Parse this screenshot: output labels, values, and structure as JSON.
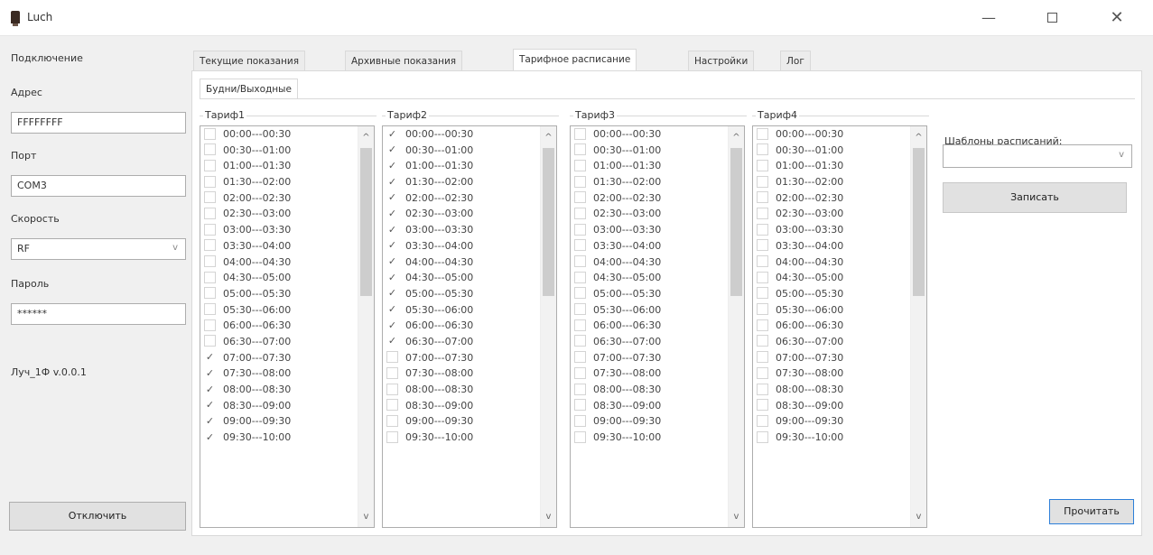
{
  "window": {
    "title": "Luch",
    "minimize_glyph": "—",
    "close_glyph": "✕"
  },
  "connection": {
    "section_title": "Подключение",
    "address_label": "Адрес",
    "address_value": "FFFFFFFF",
    "port_label": "Порт",
    "port_value": "COM3",
    "speed_label": "Скорость",
    "speed_value": "RF",
    "password_label": "Пароль",
    "password_value": "******",
    "version": "Луч_1Ф v.0.0.1",
    "disconnect_label": "Отключить"
  },
  "tabs": [
    {
      "label": "Текущие показания"
    },
    {
      "label": "Архивные показания"
    },
    {
      "label": "Тарифное расписание"
    },
    {
      "label": "Настройки"
    },
    {
      "label": "Лог"
    }
  ],
  "active_tab": "Тарифное расписание",
  "subtab": "Будни/Выходные",
  "tariffs": [
    {
      "name": "Тариф1",
      "checked": [
        false,
        false,
        false,
        false,
        false,
        false,
        false,
        false,
        false,
        false,
        false,
        false,
        false,
        false,
        true,
        true,
        true,
        true,
        true,
        true
      ]
    },
    {
      "name": "Тариф2",
      "checked": [
        true,
        true,
        true,
        true,
        true,
        true,
        true,
        true,
        true,
        true,
        true,
        true,
        true,
        true,
        false,
        false,
        false,
        false,
        false,
        false
      ]
    },
    {
      "name": "Тариф3",
      "checked": [
        false,
        false,
        false,
        false,
        false,
        false,
        false,
        false,
        false,
        false,
        false,
        false,
        false,
        false,
        false,
        false,
        false,
        false,
        false,
        false
      ]
    },
    {
      "name": "Тариф4",
      "checked": [
        false,
        false,
        false,
        false,
        false,
        false,
        false,
        false,
        false,
        false,
        false,
        false,
        false,
        false,
        false,
        false,
        false,
        false,
        false,
        false
      ]
    }
  ],
  "time_slots": [
    "00:00---00:30",
    "00:30---01:00",
    "01:00---01:30",
    "01:30---02:00",
    "02:00---02:30",
    "02:30---03:00",
    "03:00---03:30",
    "03:30---04:00",
    "04:00---04:30",
    "04:30---05:00",
    "05:00---05:30",
    "05:30---06:00",
    "06:00---06:30",
    "06:30---07:00",
    "07:00---07:30",
    "07:30---08:00",
    "08:00---08:30",
    "08:30---09:00",
    "09:00---09:30",
    "09:30---10:00"
  ],
  "templates_label": "Шаблоны расписаний:",
  "templates_value": "",
  "write_label": "Записать",
  "read_label": "Прочитать",
  "icons": {
    "checkmark": "✓",
    "scroll_up": "^",
    "scroll_down": "v",
    "dropdown": "v"
  }
}
